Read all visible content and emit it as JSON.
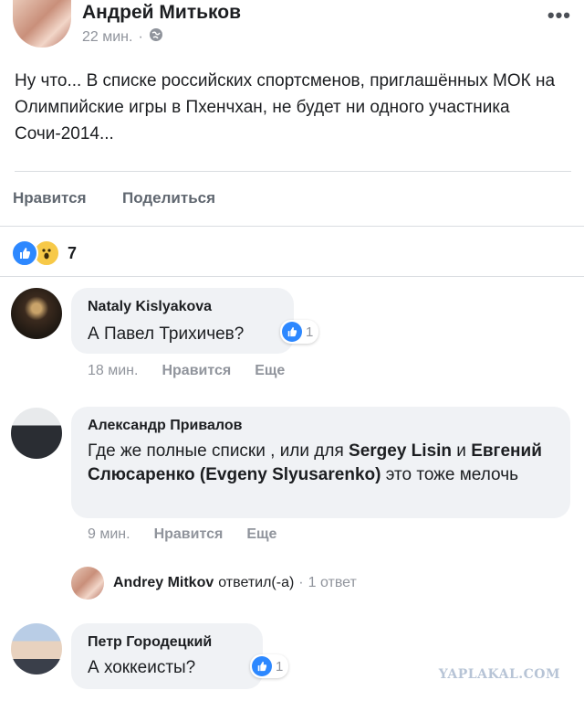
{
  "post": {
    "author": "Андрей Митьков",
    "time": "22 мин.",
    "separator": "·",
    "text": "Ну что... В списке российских спортсменов, приглашённых МОК на Олимпийские игры в Пхенчхан, не будет ни одного участника Сочи-2014...",
    "like_label": "Нравится",
    "share_label": "Поделиться",
    "reaction_count": "7",
    "reaction_icons": [
      "like-icon",
      "wow-icon"
    ]
  },
  "comments": [
    {
      "author": "Nataly Kislyakova",
      "text": "А Павел Трихичев?",
      "likes": "1",
      "time": "18 мин.",
      "like_label": "Нравится",
      "more_label": "Еще"
    },
    {
      "author": "Александр Привалов",
      "text_before": "Где же полные списки , или для ",
      "mention1": "Sergey Lisin",
      "text_and": " и ",
      "mention2": "Евгений Слюсаренко (Evgeny Slyusarenko)",
      "text_after": " это тоже мелочь",
      "time": "9 мин.",
      "like_label": "Нравится",
      "more_label": "Еще"
    },
    {
      "author": "Петр Городецкий",
      "text": "А хоккеисты?",
      "likes": "1"
    }
  ],
  "reply": {
    "author": "Andrey Mitkov",
    "action": "ответил(-а)",
    "separator": "·",
    "count": "1 ответ"
  },
  "watermark": "YAPLAKAL.COM",
  "colors": {
    "accent": "#2d88ff",
    "muted": "#90949c",
    "bubble": "#f0f2f5"
  }
}
